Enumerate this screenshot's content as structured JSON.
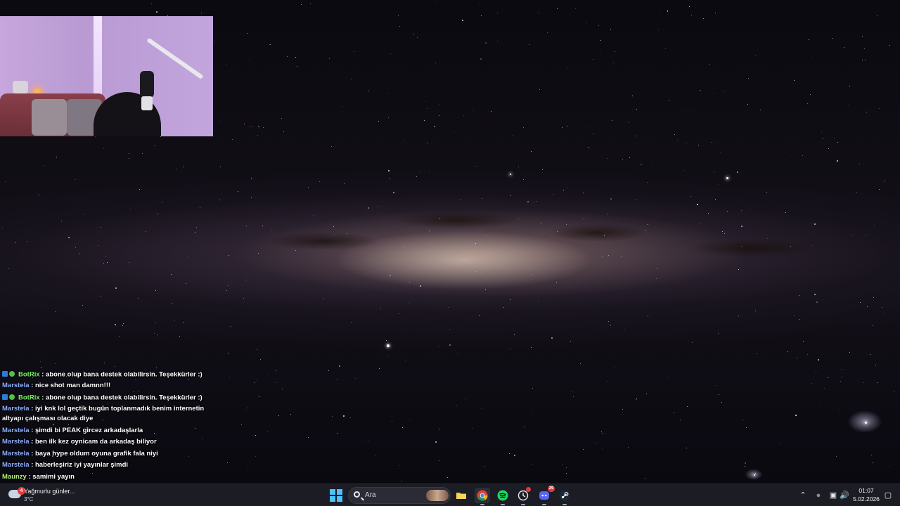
{
  "chat": {
    "messages": [
      {
        "user": "BotRix",
        "text": ": abone olup bana destek olabilirsin. Teşekkürler :)",
        "badges": true
      },
      {
        "user": "Marstela",
        "text": ": nice shot man damnn!!!"
      },
      {
        "user": "BotRix",
        "text": ": abone olup bana destek olabilirsin. Teşekkürler :)",
        "badges": true
      },
      {
        "user": "Marstela",
        "text": ": iyi knk lol geçtik bugün toplanmadık benim internetin altyapı çalışması olacak diye"
      },
      {
        "user": "Marstela",
        "text": ": şimdi bi PEAK gircez arkadaşlarla"
      },
      {
        "user": "Marstela",
        "text": ": ben ilk kez oynicam da arkadaş biliyor"
      },
      {
        "user": "Marstela",
        "text": ": baya hype oldum oyuna grafik fala niyi"
      },
      {
        "user": "Marstela",
        "text": ": haberleşiriz iyi yayınlar şimdi"
      },
      {
        "user": "Maunzy",
        "text": ": samimi yayın"
      }
    ]
  },
  "taskbar": {
    "weather": {
      "title": "Yağmurlu günler...",
      "temp": "3°C",
      "badge": "4"
    },
    "search_placeholder": "Ara",
    "apps": [
      {
        "name": "file-explorer-icon",
        "color": "#f3c142"
      },
      {
        "name": "chrome-icon",
        "color": "#4285f4"
      },
      {
        "name": "spotify-icon",
        "color": "#1ed760"
      },
      {
        "name": "app-icon",
        "color": "#3a3a44"
      },
      {
        "name": "discord-icon",
        "color": "#5865f2",
        "count": "29"
      },
      {
        "name": "steam-icon",
        "color": "#1b2838"
      }
    ],
    "clock": {
      "time": "01:07",
      "date": "5.02.2026"
    }
  }
}
